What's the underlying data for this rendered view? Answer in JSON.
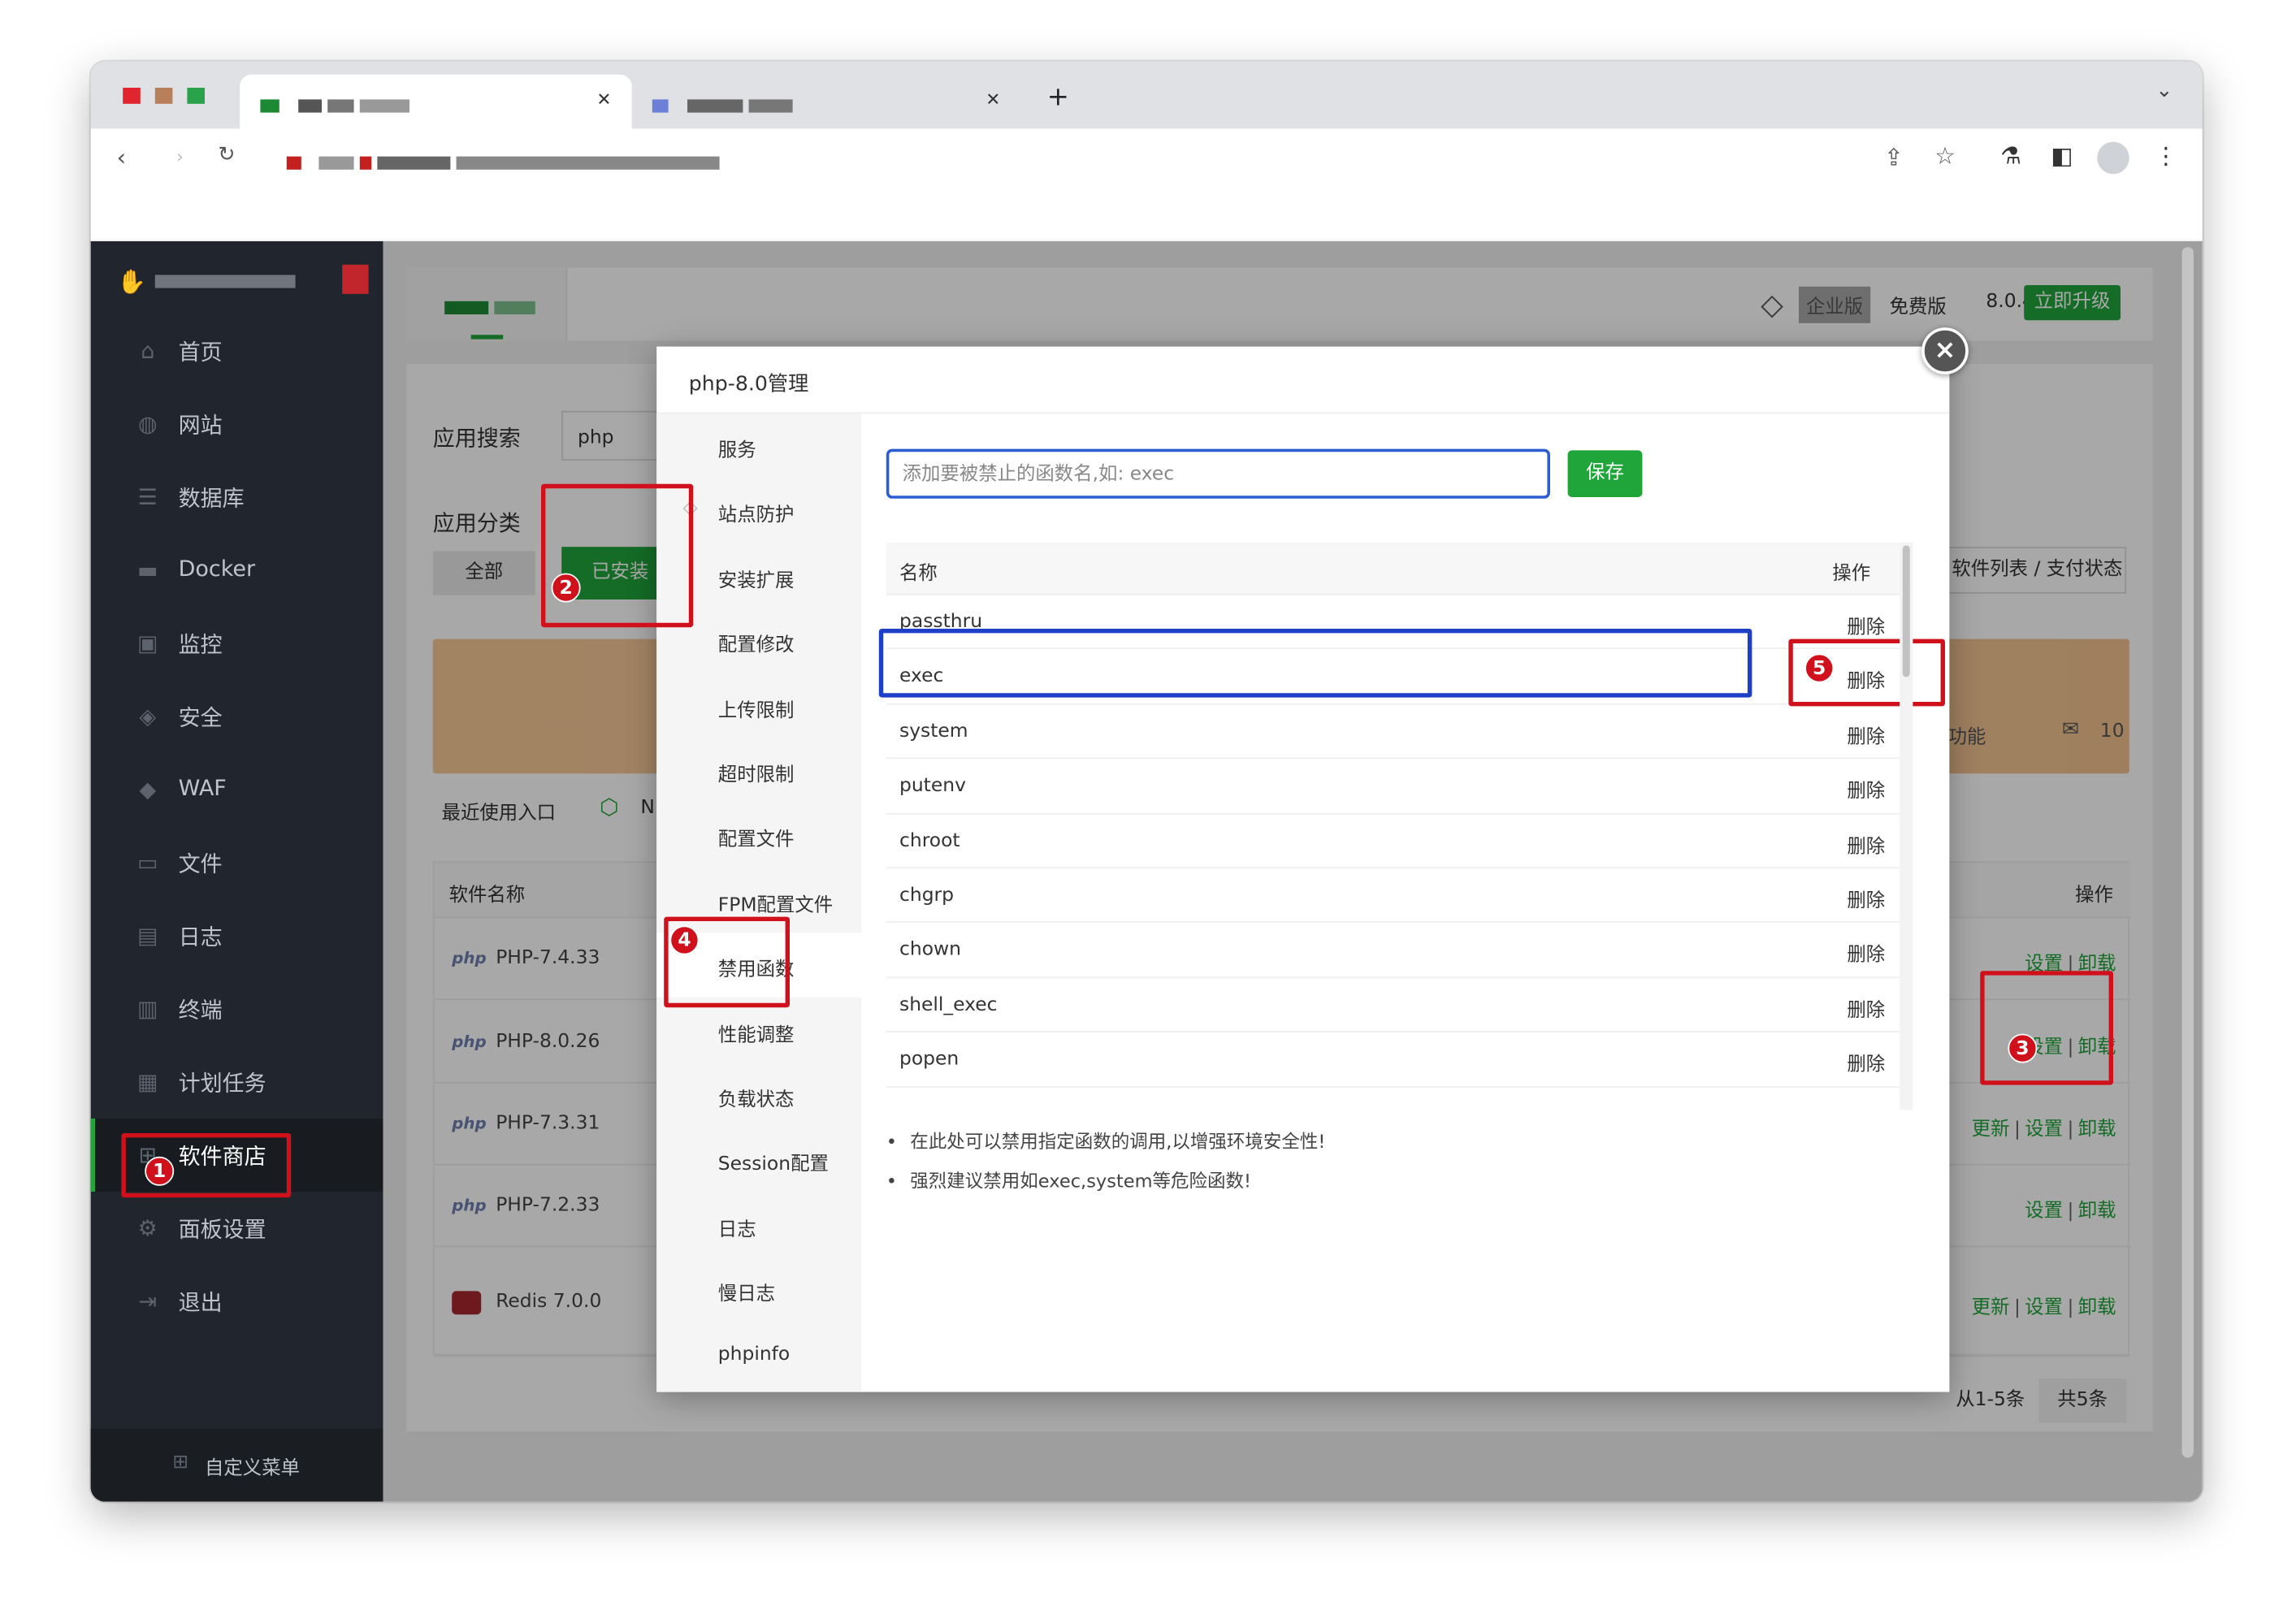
{
  "browser": {
    "tab_add": "+",
    "tabs_chevron": "⌄"
  },
  "sidebar": {
    "items": [
      {
        "label": "首页",
        "icon": "home-icon",
        "glyph": "⌂"
      },
      {
        "label": "网站",
        "icon": "globe-icon",
        "glyph": "◍"
      },
      {
        "label": "数据库",
        "icon": "database-icon",
        "glyph": "☰"
      },
      {
        "label": "Docker",
        "icon": "docker-icon",
        "glyph": "▬"
      },
      {
        "label": "监控",
        "icon": "monitor-icon",
        "glyph": "▣"
      },
      {
        "label": "安全",
        "icon": "shield-icon",
        "glyph": "◈"
      },
      {
        "label": "WAF",
        "icon": "waf-shield-icon",
        "glyph": "◆"
      },
      {
        "label": "文件",
        "icon": "folder-icon",
        "glyph": "▭"
      },
      {
        "label": "日志",
        "icon": "log-icon",
        "glyph": "▤"
      },
      {
        "label": "终端",
        "icon": "terminal-icon",
        "glyph": "▥"
      },
      {
        "label": "计划任务",
        "icon": "calendar-icon",
        "glyph": "▦"
      },
      {
        "label": "软件商店",
        "icon": "apps-icon",
        "glyph": "⊞"
      },
      {
        "label": "面板设置",
        "icon": "gear-icon",
        "glyph": "⚙"
      },
      {
        "label": "退出",
        "icon": "logout-icon",
        "glyph": "⇥"
      }
    ],
    "custom_menu": "自定义菜单"
  },
  "topbar": {
    "enterprise": "企业版",
    "free": "免费版",
    "version": "8.0.4",
    "upgrade": "立即升级"
  },
  "store": {
    "search_label": "应用搜索",
    "search_value": "php",
    "category_label": "应用分类",
    "cat_all": "全部",
    "cat_installed": "已安装",
    "software_list_btn": "软件列表 / 支付状态",
    "recent_label": "最近使用入口",
    "recent_partial": "N",
    "banner_right_text": "功能",
    "banner_right_num": "10",
    "col_name": "软件名称",
    "col_ops": "操作",
    "rows": [
      {
        "badge": "php",
        "name": "PHP-7.4.33",
        "update": "",
        "set": "设置",
        "sep": "|",
        "uninstall": "卸载"
      },
      {
        "badge": "php",
        "name": "PHP-8.0.26",
        "update": "",
        "set": "设置",
        "sep": "|",
        "uninstall": "卸载"
      },
      {
        "badge": "php",
        "name": "PHP-7.3.31",
        "update": "更新",
        "set": "设置",
        "sep": "|",
        "uninstall": "卸载"
      },
      {
        "badge": "php",
        "name": "PHP-7.2.33",
        "update": "",
        "set": "设置",
        "sep": "|",
        "uninstall": "卸载"
      },
      {
        "badge": "",
        "name": "Redis 7.0.0",
        "update": "更新",
        "set": "设置",
        "sep": "|",
        "uninstall": "卸载"
      }
    ],
    "pager_range": "从1-5条",
    "pager_total": "共5条"
  },
  "modal": {
    "title": "php-8.0管理",
    "nav": [
      "服务",
      "站点防护",
      "安装扩展",
      "配置修改",
      "上传限制",
      "超时限制",
      "配置文件",
      "FPM配置文件",
      "禁用函数",
      "性能调整",
      "负载状态",
      "Session配置",
      "日志",
      "慢日志",
      "phpinfo"
    ],
    "input_placeholder": "添加要被禁止的函数名,如: exec",
    "save": "保存",
    "col_name": "名称",
    "col_op": "操作",
    "functions": [
      "passthru",
      "exec",
      "system",
      "putenv",
      "chroot",
      "chgrp",
      "chown",
      "shell_exec",
      "popen"
    ],
    "delete": "删除",
    "notes": [
      "在此处可以禁用指定函数的调用,以增强环境安全性!",
      "强烈建议禁用如exec,system等危险函数!"
    ],
    "close": "×"
  },
  "annotations": [
    "1",
    "2",
    "3",
    "4",
    "5"
  ],
  "colors": {
    "accent_green": "#20a53a",
    "sidebar_bg": "#21262e",
    "highlight_red": "#d0101a",
    "highlight_blue": "#1e3fc8"
  }
}
